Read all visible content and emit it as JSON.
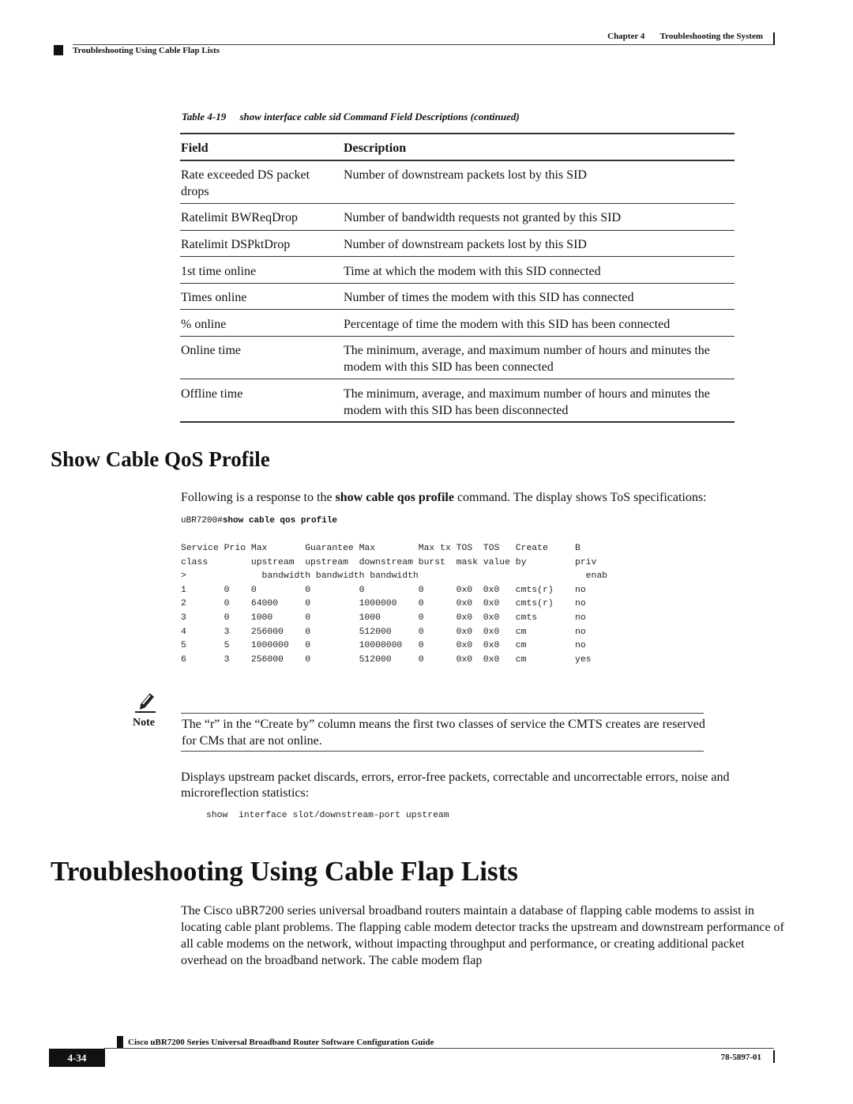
{
  "header": {
    "chapter": "Chapter 4",
    "chapter_title": "Troubleshooting the System",
    "section": "Troubleshooting Using Cable Flap Lists"
  },
  "table": {
    "caption_number": "Table 4-19",
    "caption_text": "show interface cable sid Command Field Descriptions (continued)",
    "headers": {
      "field": "Field",
      "description": "Description"
    },
    "rows": [
      {
        "field": "Rate exceeded DS packet drops",
        "description": "Number of downstream packets lost by this SID"
      },
      {
        "field": "Ratelimit BWReqDrop",
        "description": "Number of bandwidth requests not granted by this SID"
      },
      {
        "field": "Ratelimit DSPktDrop",
        "description": "Number of downstream packets lost by this SID"
      },
      {
        "field": "1st time online",
        "description": "Time at which the modem with this SID connected"
      },
      {
        "field": "Times online",
        "description": "Number of times the modem with this SID has connected"
      },
      {
        "field": "% online",
        "description": "Percentage of time the modem with this SID has been connected"
      },
      {
        "field": "Online time",
        "description": "The minimum, average, and maximum number of hours and minutes the modem with this SID has been connected"
      },
      {
        "field": "Offline time",
        "description": "The minimum, average, and maximum number of hours and minutes the modem with this SID has been disconnected"
      }
    ]
  },
  "qos_section": {
    "heading": "Show Cable QoS Profile",
    "intro_prefix": "Following is a response to the ",
    "intro_command": "show cable qos profile",
    "intro_suffix": " command. The display shows ToS specifications:",
    "prompt": "uBR7200#",
    "command": "show cable qos profile",
    "output_header_lines": [
      "Service Prio Max       Guarantee Max        Max tx TOS  TOS   Create     B",
      "class        upstream  upstream  downstream burst  mask value by         priv",
      ">              bandwidth bandwidth bandwidth                               enab"
    ],
    "output_rows": [
      [
        "1",
        "0",
        "0",
        "0",
        "0",
        "0",
        "0x0",
        "0x0",
        "cmts(r)",
        "no"
      ],
      [
        "2",
        "0",
        "64000",
        "0",
        "1000000",
        "0",
        "0x0",
        "0x0",
        "cmts(r)",
        "no"
      ],
      [
        "3",
        "0",
        "1000",
        "0",
        "1000",
        "0",
        "0x0",
        "0x0",
        "cmts",
        "no"
      ],
      [
        "4",
        "3",
        "256000",
        "0",
        "512000",
        "0",
        "0x0",
        "0x0",
        "cm",
        "no"
      ],
      [
        "5",
        "5",
        "1000000",
        "0",
        "10000000",
        "0",
        "0x0",
        "0x0",
        "cm",
        "no"
      ],
      [
        "6",
        "3",
        "256000",
        "0",
        "512000",
        "0",
        "0x0",
        "0x0",
        "cm",
        "yes"
      ]
    ]
  },
  "note": {
    "icon": "pencil-note-icon",
    "label": "Note",
    "text": "The “r” in the “Create by” column means the first two classes of service the CMTS creates are reserved for CMs that are not online."
  },
  "displays_text": "Displays upstream packet discards, errors, error-free packets, correctable and uncorrectable errors, noise and microreflection statistics:",
  "show_command": "show  interface slot/downstream-port upstream",
  "flap_section": {
    "heading": "Troubleshooting Using Cable Flap Lists",
    "paragraph": "The Cisco uBR7200 series universal broadband routers maintain a database of flapping cable modems to assist in locating cable plant problems. The flapping cable modem detector tracks the upstream and downstream performance of all cable modems on the network, without impacting throughput and performance, or creating additional packet overhead on the broadband network. The cable modem flap"
  },
  "footer": {
    "guide_title": "Cisco uBR7200 Series Universal Broadband Router Software Configuration Guide",
    "page_number": "4-34",
    "doc_number": "78-5897-01"
  }
}
